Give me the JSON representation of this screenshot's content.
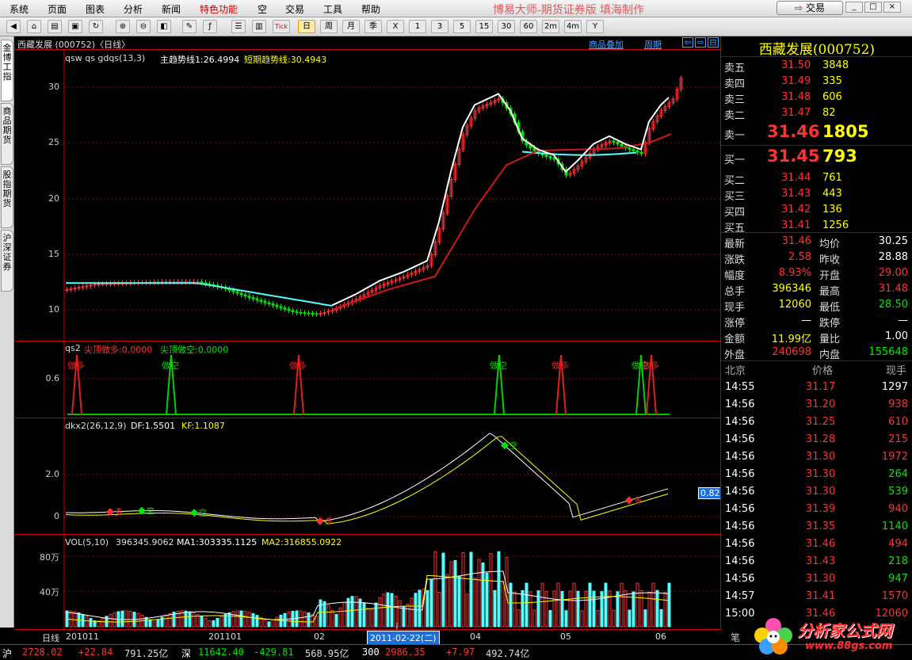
{
  "menubar": {
    "items": [
      "系统",
      "页面",
      "图表",
      "分析",
      "新闻",
      "特色功能",
      "空",
      "交易",
      "工具",
      "帮助"
    ],
    "app_title": "博易大师-期货证券版 填海制作",
    "trade_button": "交易"
  },
  "toolbar": {
    "buttons": [
      "日",
      "周",
      "月",
      "季",
      "X",
      "1",
      "3",
      "5",
      "15",
      "30",
      "60",
      "2m",
      "4m",
      "Y"
    ],
    "tick_label": "Tick"
  },
  "sidebar": {
    "tabs": [
      "金博工指",
      "商品期货",
      "股指期货",
      "沪深证券"
    ]
  },
  "chart": {
    "title": "西藏发展 (000752)〈日线〉",
    "overlay_link": "商品叠加",
    "period_link": "周期",
    "main_indicator": {
      "names": "qsw  qs  gdqs(13,3)",
      "main_trend": "主趋势线1:26.4994",
      "short_trend": "短期趋势线:30.4943"
    },
    "y_labels_main": [
      "30",
      "25",
      "20",
      "15",
      "10"
    ],
    "qs2": {
      "name": "qs2",
      "long_label": "尖顶做多:0.0000",
      "short_label": "尖顶做空:0.0000",
      "y_label": "0.6",
      "signal_long": "做多",
      "signal_short": "做空"
    },
    "dkx2": {
      "name": "dkx2(26,12,9)",
      "df": "DF:1.5501",
      "kf": "KF:1.1087",
      "y_labels": [
        "2.0",
        "0"
      ],
      "current_value": "0.82",
      "signal_long": "多",
      "signal_short": "空"
    },
    "vol": {
      "name": "VOL(5,10)",
      "value": "396345.9062",
      "ma1": "MA1:303335.1125",
      "ma2": "MA2:316855.0922",
      "y_labels": [
        "80万",
        "40万"
      ]
    },
    "date_axis": {
      "period": "日线",
      "labels": [
        "201011",
        "201101",
        "02",
        "04",
        "05",
        "06"
      ],
      "cursor_date": "2011-02-22(二)"
    },
    "colors": {
      "up": "#ff3232",
      "down": "#00e600",
      "cyan": "#54ffff",
      "yellow": "#ffff00",
      "white": "#ffffff"
    }
  },
  "quote": {
    "name": "西藏发展(000752)",
    "asks": [
      {
        "label": "卖五",
        "price": "31.50",
        "vol": "3848"
      },
      {
        "label": "卖四",
        "price": "31.49",
        "vol": "335"
      },
      {
        "label": "卖三",
        "price": "31.48",
        "vol": "606"
      },
      {
        "label": "卖二",
        "price": "31.47",
        "vol": "82"
      },
      {
        "label": "卖一",
        "price": "31.46",
        "vol": "1805"
      }
    ],
    "bids": [
      {
        "label": "买一",
        "price": "31.45",
        "vol": "793"
      },
      {
        "label": "买二",
        "price": "31.44",
        "vol": "761"
      },
      {
        "label": "买三",
        "price": "31.43",
        "vol": "443"
      },
      {
        "label": "买四",
        "price": "31.42",
        "vol": "136"
      },
      {
        "label": "买五",
        "price": "31.41",
        "vol": "1256"
      }
    ],
    "stats": [
      {
        "l1": "最新",
        "v1": "31.46",
        "l2": "均价",
        "v2": "30.25",
        "c1": "#ff3232",
        "c2": "#fff"
      },
      {
        "l1": "涨跌",
        "v1": "2.58",
        "l2": "昨收",
        "v2": "28.88",
        "c1": "#ff3232",
        "c2": "#fff"
      },
      {
        "l1": "幅度",
        "v1": "8.93%",
        "l2": "开盘",
        "v2": "29.00",
        "c1": "#ff3232",
        "c2": "#ff3232"
      },
      {
        "l1": "总手",
        "v1": "396346",
        "l2": "最高",
        "v2": "31.48",
        "c1": "#ffff00",
        "c2": "#ff3232"
      },
      {
        "l1": "现手",
        "v1": "12060",
        "l2": "最低",
        "v2": "28.50",
        "c1": "#ffff00",
        "c2": "#00e600"
      },
      {
        "l1": "涨停",
        "v1": "—",
        "l2": "跌停",
        "v2": "—",
        "c1": "#fff",
        "c2": "#fff"
      },
      {
        "l1": "金额",
        "v1": "11.99亿",
        "l2": "量比",
        "v2": "1.00",
        "c1": "#ffff00",
        "c2": "#fff"
      },
      {
        "l1": "外盘",
        "v1": "240698",
        "l2": "内盘",
        "v2": "155648",
        "c1": "#ff3232",
        "c2": "#00e600"
      }
    ],
    "ticks_header": {
      "city": "北京",
      "price": "价格",
      "vol": "现手"
    },
    "ticks": [
      {
        "time": "14:55",
        "price": "31.17",
        "vol": "1297",
        "pc": "#ff3232",
        "vc": "#fff"
      },
      {
        "time": "14:56",
        "price": "31.20",
        "vol": "938",
        "pc": "#ff3232",
        "vc": "#ff3232"
      },
      {
        "time": "14:56",
        "price": "31.25",
        "vol": "610",
        "pc": "#ff3232",
        "vc": "#ff3232"
      },
      {
        "time": "14:56",
        "price": "31.28",
        "vol": "215",
        "pc": "#ff3232",
        "vc": "#ff3232"
      },
      {
        "time": "14:56",
        "price": "31.30",
        "vol": "1972",
        "pc": "#ff3232",
        "vc": "#ff3232"
      },
      {
        "time": "14:56",
        "price": "31.30",
        "vol": "264",
        "pc": "#ff3232",
        "vc": "#00e600"
      },
      {
        "time": "14:56",
        "price": "31.30",
        "vol": "539",
        "pc": "#ff3232",
        "vc": "#00e600"
      },
      {
        "time": "14:56",
        "price": "31.39",
        "vol": "940",
        "pc": "#ff3232",
        "vc": "#ff3232"
      },
      {
        "time": "14:56",
        "price": "31.35",
        "vol": "1140",
        "pc": "#ff3232",
        "vc": "#00e600"
      },
      {
        "time": "14:56",
        "price": "31.46",
        "vol": "494",
        "pc": "#ff3232",
        "vc": "#ff3232"
      },
      {
        "time": "14:56",
        "price": "31.43",
        "vol": "218",
        "pc": "#ff3232",
        "vc": "#00e600"
      },
      {
        "time": "14:56",
        "price": "31.30",
        "vol": "947",
        "pc": "#ff3232",
        "vc": "#00e600"
      },
      {
        "time": "14:57",
        "price": "31.41",
        "vol": "1570",
        "pc": "#ff3232",
        "vc": "#ff3232"
      },
      {
        "time": "15:00",
        "price": "31.46",
        "vol": "12060",
        "pc": "#ff3232",
        "vc": "#ff3232"
      }
    ]
  },
  "status_bar": {
    "sh_label": "沪",
    "sh_index": "2728.02",
    "sh_change": "+22.84",
    "sh_amount": "791.25亿",
    "sz_label": "深",
    "sz_index": "11642.40",
    "sz_change": "-429.81",
    "sz_amount": "568.95亿",
    "c300_label": "300",
    "c300_index": "2986.35",
    "c300_change": "+7.97",
    "c300_amount": "492.74亿"
  },
  "logo": {
    "text": "分析家公式网",
    "url": "www.88gs.com",
    "side_char": "笔"
  }
}
